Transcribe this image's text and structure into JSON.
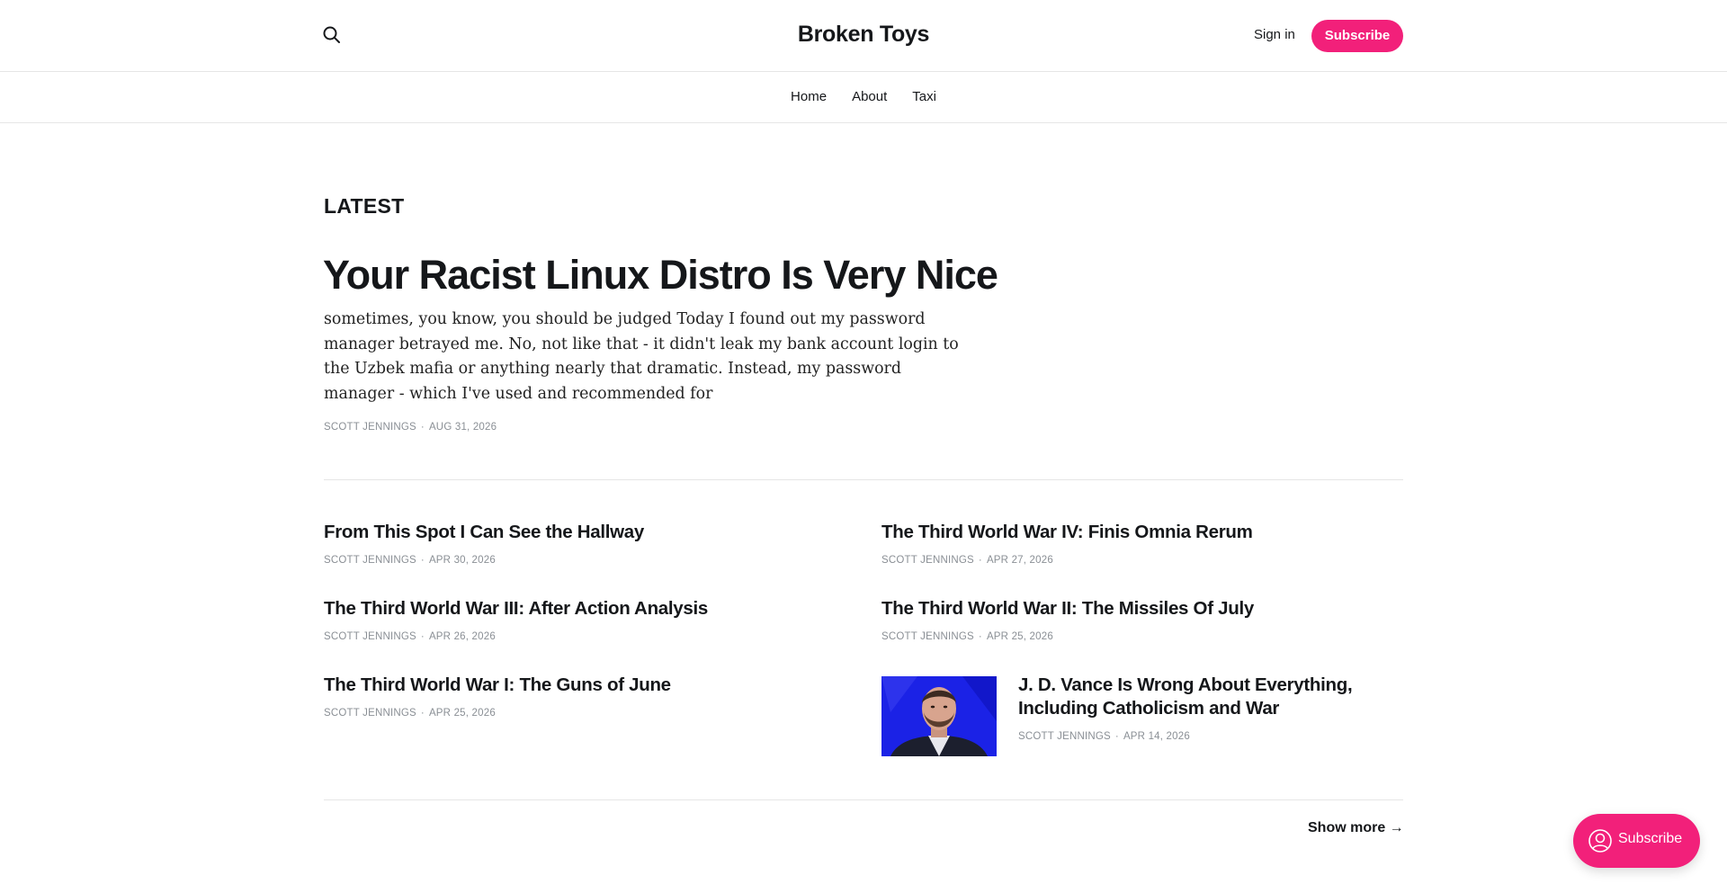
{
  "header": {
    "site_title": "Broken Toys",
    "search_icon": "search-icon",
    "signin_label": "Sign in",
    "subscribe_label": "Subscribe",
    "accent_color": "#f2207a"
  },
  "nav": {
    "items": [
      {
        "label": "Home"
      },
      {
        "label": "About"
      },
      {
        "label": "Taxi"
      }
    ]
  },
  "latest": {
    "section_label": "LATEST",
    "featured": {
      "title": "Your Racist Linux Distro Is Very Nice",
      "excerpt": "sometimes, you know, you should be judged Today I found out my password manager betrayed me. No, not like that - it didn't leak my bank account login to the Uzbek mafia or anything nearly that dramatic. Instead, my password manager - which I've used and recommended for",
      "author": "SCOTT JENNINGS",
      "date": "AUG 31, 2026"
    }
  },
  "posts": [
    {
      "title": "From This Spot I Can See the Hallway",
      "author": "SCOTT JENNINGS",
      "date": "APR 30, 2026"
    },
    {
      "title": "The Third World War IV: Finis Omnia Rerum",
      "author": "SCOTT JENNINGS",
      "date": "APR 27, 2026"
    },
    {
      "title": "The Third World War III: After Action Analysis",
      "author": "SCOTT JENNINGS",
      "date": "APR 26, 2026"
    },
    {
      "title": "The Third World War II: The Missiles Of July",
      "author": "SCOTT JENNINGS",
      "date": "APR 25, 2026"
    },
    {
      "title": "The Third World War I: The Guns of June",
      "author": "SCOTT JENNINGS",
      "date": "APR 25, 2026"
    },
    {
      "title_line1": "J. D. Vance Is Wrong About Everything,",
      "title_line2": "Including Catholicism and War",
      "author": "SCOTT JENNINGS",
      "date": "APR 14, 2026"
    }
  ],
  "show_more_label": "Show more →",
  "portal": {
    "label": "Subscribe",
    "icon": "user-circle-icon"
  }
}
